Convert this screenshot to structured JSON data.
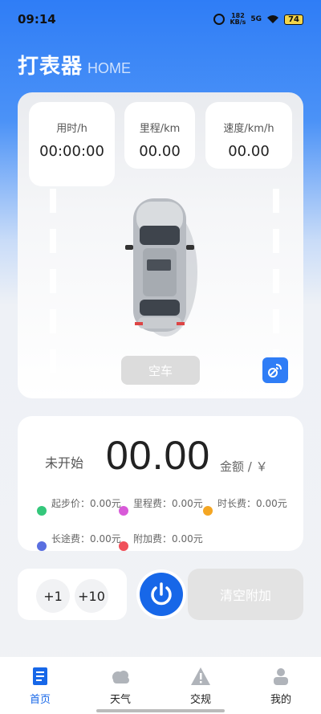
{
  "status_bar": {
    "time": "09:14",
    "netspeed_value": "182",
    "netspeed_unit": "KB/s",
    "network": "5G",
    "battery": "74"
  },
  "header": {
    "title": "打表器",
    "subtitle": "HOME"
  },
  "stats": {
    "time_label": "用时/h",
    "time_value": "00:00:00",
    "distance_label": "里程/km",
    "distance_value": "00.00",
    "speed_label": "速度/km/h",
    "speed_value": "00.00"
  },
  "car_status_button": "空车",
  "fare": {
    "state": "未开始",
    "amount": "00.00",
    "unit": "金额 / ￥",
    "fees": [
      {
        "text": "起步价：0.00元",
        "color": "#34c77b"
      },
      {
        "text": "里程费：0.00元",
        "color": "#d85ad8"
      },
      {
        "text": "时长费：0.00元",
        "color": "#f4a623"
      },
      {
        "text": "长途费：0.00元",
        "color": "#5a6fe0"
      },
      {
        "text": "附加费：0.00元",
        "color": "#f0505a"
      }
    ]
  },
  "controls": {
    "plus_one": "+1",
    "plus_ten": "+10",
    "clear_label": "清空附加"
  },
  "tabs": [
    {
      "label": "首页",
      "icon": "home-doc-icon",
      "active": true
    },
    {
      "label": "天气",
      "icon": "cloud-icon",
      "active": false
    },
    {
      "label": "交规",
      "icon": "warning-icon",
      "active": false
    },
    {
      "label": "我的",
      "icon": "user-icon",
      "active": false
    }
  ],
  "colors": {
    "accent": "#1767e8",
    "header_gradient_top": "#2f7df6"
  }
}
